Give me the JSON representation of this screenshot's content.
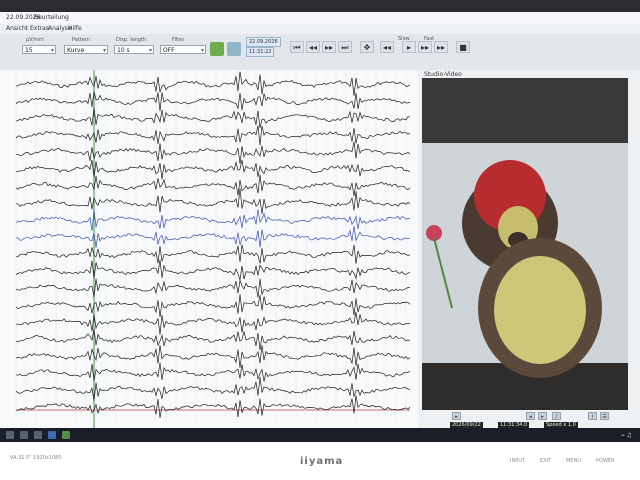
{
  "window": {
    "date": "22.09.2026",
    "title": "Beurteilung"
  },
  "menu": [
    "Ansicht",
    "Extras",
    "Analyse",
    "Hilfe"
  ],
  "toolbar": {
    "sens_label": "µV/mm",
    "sens_value": "15",
    "pattern_label": "Pattern",
    "pattern_value": "Kurve",
    "epoch_label": "Disp. length",
    "epoch_value": "10 s",
    "filter_label": "Filter",
    "filter_value": "OFF",
    "record_date": "22.09.2026",
    "record_time": "11:31:22",
    "speed_label": "Slow",
    "fast_label": "Fast"
  },
  "video": {
    "title": "Studio-Video",
    "date": "2026/09/22",
    "time": "11:31:34.0",
    "speed": "Speed x 1.0"
  },
  "bezel": {
    "brand": "iiyama",
    "left_info": "VA   31.5\"   1920x1080",
    "buttons": [
      "INPUT",
      "EXIT",
      "MENU",
      "POWER"
    ]
  },
  "colors": {
    "trace": "#1c1c1c",
    "trace_blue": "#3c4fb0",
    "marker_green": "#2f9e46",
    "marker_red": "#b7373a"
  },
  "eeg": {
    "channel_count": 20,
    "blue_channels": [
      8,
      9
    ]
  }
}
